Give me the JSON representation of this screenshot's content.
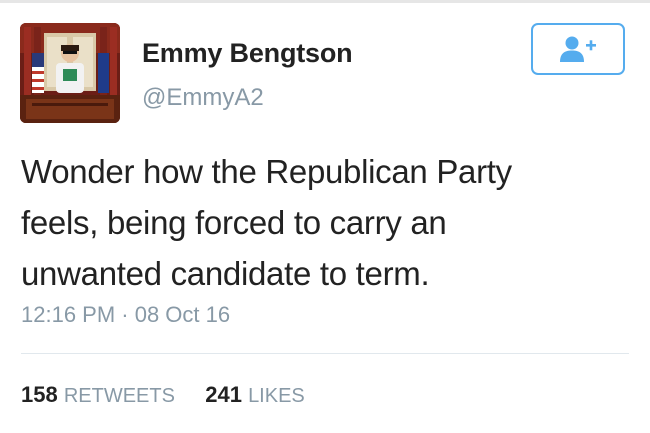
{
  "tweet": {
    "author": {
      "name": "Emmy Bengtson",
      "handle": "@EmmyA2"
    },
    "text_lines": [
      "Wonder how the Republican Party",
      "feels, being forced to carry an",
      "unwanted candidate to term."
    ],
    "timestamp": "12:16 PM · 08 Oct 16",
    "stats": {
      "retweets_count": "158",
      "retweets_label": "RETWEETS",
      "likes_count": "241",
      "likes_label": "LIKES"
    }
  },
  "follow_button": {
    "icon": "add-user-icon"
  },
  "colors": {
    "accent": "#55acee",
    "text": "#222222",
    "muted": "#8899a6",
    "divider": "#e1e8ed"
  }
}
